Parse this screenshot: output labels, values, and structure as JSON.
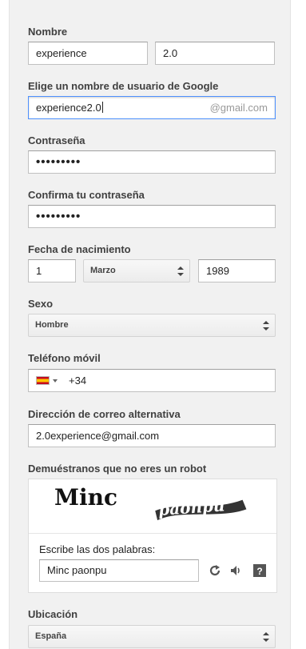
{
  "form": {
    "name_label": "Nombre",
    "first_name": "experience",
    "last_name": "2.0",
    "username_label": "Elige un nombre de usuario de Google",
    "username": "experience2.0",
    "username_suffix": "@gmail.com",
    "password_label": "Contraseña",
    "password_mask": "•••••••••",
    "confirm_label": "Confirma tu contraseña",
    "confirm_mask": "•••••••••",
    "birthdate_label": "Fecha de nacimiento",
    "birth_day": "1",
    "birth_month": "Marzo",
    "birth_year": "1989",
    "gender_label": "Sexo",
    "gender": "Hombre",
    "phone_label": "Teléfono móvil",
    "phone_prefix": "+34",
    "phone_flag_icon": "spain-flag-icon",
    "alt_email_label": "Dirección de correo alternativa",
    "alt_email": "2.0experience@gmail.com",
    "captcha_label": "Demuéstranos que no eres un robot",
    "captcha_words": [
      "Minc",
      "paonpu"
    ],
    "captcha_prompt": "Escribe las dos palabras:",
    "captcha_answer": "Minc paonpu",
    "captcha_icons": [
      "refresh-icon",
      "audio-icon",
      "help-icon"
    ],
    "location_label": "Ubicación",
    "location": "España"
  },
  "colors": {
    "panel_bg": "#f1f1f1",
    "focus_border": "#4d90fe",
    "label_text": "#404040"
  }
}
